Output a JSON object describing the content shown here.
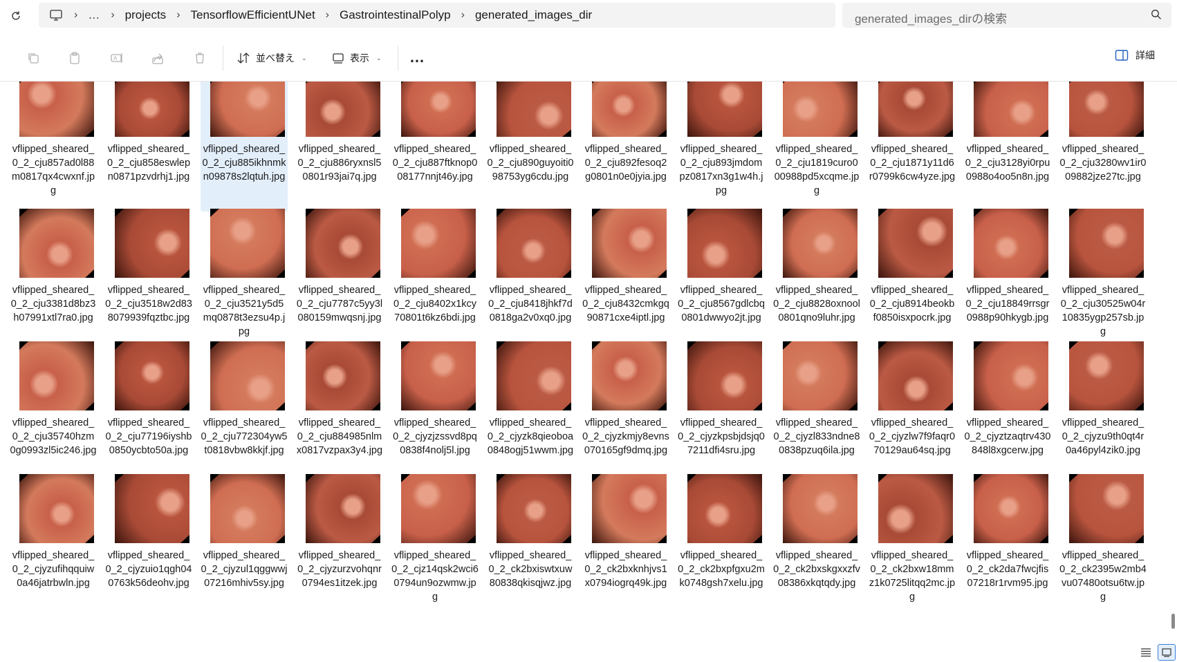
{
  "address": {
    "breadcrumbs": [
      "projects",
      "TensorflowEfficientUNet",
      "GastrointestinalPolyp",
      "generated_images_dir"
    ],
    "more_label": "…",
    "search_placeholder": "generated_images_dirの検索"
  },
  "toolbar": {
    "sort_label": "並べ替え",
    "view_label": "表示",
    "details_label": "詳細",
    "more_label": "…"
  },
  "files": [
    {
      "name": "vflipped_sheared_0_2_cju857ad0l88m0817qx4cwxnf.jpg",
      "selected": false
    },
    {
      "name": "vflipped_sheared_0_2_cju858eswlepn0871pzvdrhj1.jpg",
      "selected": false
    },
    {
      "name": "vflipped_sheared_0_2_cju885ikhnmkn09878s2lqtuh.jpg",
      "selected": true
    },
    {
      "name": "vflipped_sheared_0_2_cju886ryxnsl50801r93jai7q.jpg",
      "selected": false
    },
    {
      "name": "vflipped_sheared_0_2_cju887ftknop008177nnjt46y.jpg",
      "selected": false
    },
    {
      "name": "vflipped_sheared_0_2_cju890guyoiti098753yg6cdu.jpg",
      "selected": false
    },
    {
      "name": "vflipped_sheared_0_2_cju892fesoq2g0801n0e0jyia.jpg",
      "selected": false
    },
    {
      "name": "vflipped_sheared_0_2_cju893jmdompz0817xn3g1w4h.jpg",
      "selected": false
    },
    {
      "name": "vflipped_sheared_0_2_cju1819curo000988pd5xcqme.jpg",
      "selected": false
    },
    {
      "name": "vflipped_sheared_0_2_cju1871y11d6r0799k6cw4yze.jpg",
      "selected": false
    },
    {
      "name": "vflipped_sheared_0_2_cju3128yi0rpu0988o4oo5n8n.jpg",
      "selected": false
    },
    {
      "name": "vflipped_sheared_0_2_cju3280wv1ir009882jze27tc.jpg",
      "selected": false
    },
    {
      "name": "vflipped_sheared_0_2_cju3381d8bz3h07991xtl7ra0.jpg",
      "selected": false
    },
    {
      "name": "vflipped_sheared_0_2_cju3518w2d838079939fqztbc.jpg",
      "selected": false
    },
    {
      "name": "vflipped_sheared_0_2_cju3521y5d5mq0878t3ezsu4p.jpg",
      "selected": false
    },
    {
      "name": "vflipped_sheared_0_2_cju7787c5yy3l080159mwqsnj.jpg",
      "selected": false
    },
    {
      "name": "vflipped_sheared_0_2_cju8402x1kcy70801t6kz6bdi.jpg",
      "selected": false
    },
    {
      "name": "vflipped_sheared_0_2_cju8418jhkf7d0818ga2v0xq0.jpg",
      "selected": false
    },
    {
      "name": "vflipped_sheared_0_2_cju8432cmkgq90871cxe4iptl.jpg",
      "selected": false
    },
    {
      "name": "vflipped_sheared_0_2_cju8567gdlcbq0801dwwyo2jt.jpg",
      "selected": false
    },
    {
      "name": "vflipped_sheared_0_2_cju8828oxnool0801qno9luhr.jpg",
      "selected": false
    },
    {
      "name": "vflipped_sheared_0_2_cju8914beokbf0850isxpocrk.jpg",
      "selected": false
    },
    {
      "name": "vflipped_sheared_0_2_cju18849rrsgr0988p90hkygb.jpg",
      "selected": false
    },
    {
      "name": "vflipped_sheared_0_2_cju30525w04r10835ygp257sb.jpg",
      "selected": false
    },
    {
      "name": "vflipped_sheared_0_2_cju35740hzm0g0993zl5ic246.jpg",
      "selected": false
    },
    {
      "name": "vflipped_sheared_0_2_cju77196iyshb0850ycbto50a.jpg",
      "selected": false
    },
    {
      "name": "vflipped_sheared_0_2_cju772304yw5t0818vbw8kkjf.jpg",
      "selected": false
    },
    {
      "name": "vflipped_sheared_0_2_cju884985nlmx0817vzpax3y4.jpg",
      "selected": false
    },
    {
      "name": "vflipped_sheared_0_2_cjyzjzssvd8pq0838f4nolj5l.jpg",
      "selected": false
    },
    {
      "name": "vflipped_sheared_0_2_cjyzk8qieoboa0848ogj51wwm.jpg",
      "selected": false
    },
    {
      "name": "vflipped_sheared_0_2_cjyzkmjy8evns070165gf9dmq.jpg",
      "selected": false
    },
    {
      "name": "vflipped_sheared_0_2_cjyzkpsbjdsjq07211dfi4sru.jpg",
      "selected": false
    },
    {
      "name": "vflipped_sheared_0_2_cjyzl833ndne80838pzuq6ila.jpg",
      "selected": false
    },
    {
      "name": "vflipped_sheared_0_2_cjyzlw7f9faqr070129au64sq.jpg",
      "selected": false
    },
    {
      "name": "vflipped_sheared_0_2_cjyztzaqtrv430848l8xgcerw.jpg",
      "selected": false
    },
    {
      "name": "vflipped_sheared_0_2_cjyzu9th0qt4r0a46pyl4zik0.jpg",
      "selected": false
    },
    {
      "name": "vflipped_sheared_0_2_cjyzufihqquiw0a46jatrbwln.jpg",
      "selected": false
    },
    {
      "name": "vflipped_sheared_0_2_cjyzuio1qgh040763k56deohv.jpg",
      "selected": false
    },
    {
      "name": "vflipped_sheared_0_2_cjyzul1qggwwj07216mhiv5sy.jpg",
      "selected": false
    },
    {
      "name": "vflipped_sheared_0_2_cjyzurzvohqnr0794es1itzek.jpg",
      "selected": false
    },
    {
      "name": "vflipped_sheared_0_2_cjz14qsk2wci60794un9ozwmw.jpg",
      "selected": false
    },
    {
      "name": "vflipped_sheared_0_2_ck2bxiswtxuw80838qkisqjwz.jpg",
      "selected": false
    },
    {
      "name": "vflipped_sheared_0_2_ck2bxknhjvs1x0794iogrq49k.jpg",
      "selected": false
    },
    {
      "name": "vflipped_sheared_0_2_ck2bxpfgxu2mk0748gsh7xelu.jpg",
      "selected": false
    },
    {
      "name": "vflipped_sheared_0_2_ck2bxskgxxzfv08386xkqtqdy.jpg",
      "selected": false
    },
    {
      "name": "vflipped_sheared_0_2_ck2bxw18mmz1k0725litqq2mc.jpg",
      "selected": false
    },
    {
      "name": "vflipped_sheared_0_2_ck2da7fwcjfis07218r1rvm95.jpg",
      "selected": false
    },
    {
      "name": "vflipped_sheared_0_2_ck2395w2mb4vu07480otsu6tw.jpg",
      "selected": false
    }
  ],
  "thumb_palette": [
    "#c8604a",
    "#b8543e",
    "#d47a5c",
    "#a84a36",
    "#cf6d52",
    "#bb5a44"
  ],
  "accent_color": "#3b7ddd"
}
